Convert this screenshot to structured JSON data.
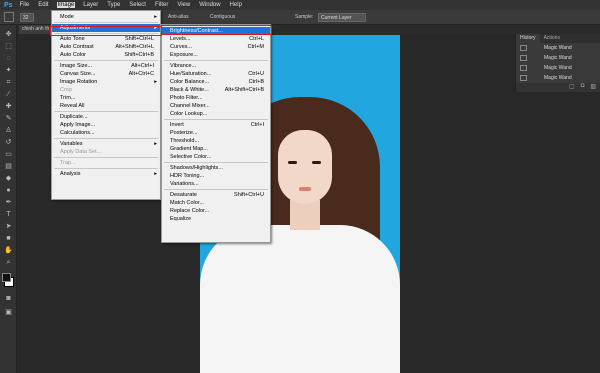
{
  "app": {
    "logo": "Ps",
    "menus": [
      "File",
      "Edit",
      "Image",
      "Layer",
      "Type",
      "Select",
      "Filter",
      "View",
      "Window",
      "Help"
    ],
    "active_menu": "Image"
  },
  "options": {
    "sample_size": "32",
    "antialias": "Anti-alias",
    "contiguous": "Contiguous",
    "sample_label": "Sample:",
    "sample_value": "Current Layer"
  },
  "document_tab": "chinh anh th",
  "image_menu": [
    {
      "label": "Mode",
      "arrow": true
    },
    {
      "sep": true
    },
    {
      "label": "Adjustments",
      "arrow": true,
      "highlight": true
    },
    {
      "sep": true
    },
    {
      "label": "Auto Tone",
      "shortcut": "Shift+Ctrl+L"
    },
    {
      "label": "Auto Contrast",
      "shortcut": "Alt+Shift+Ctrl+L"
    },
    {
      "label": "Auto Color",
      "shortcut": "Shift+Ctrl+B"
    },
    {
      "sep": true
    },
    {
      "label": "Image Size...",
      "shortcut": "Alt+Ctrl+I"
    },
    {
      "label": "Canvas Size...",
      "shortcut": "Alt+Ctrl+C"
    },
    {
      "label": "Image Rotation",
      "arrow": true
    },
    {
      "label": "Crop",
      "disabled": true
    },
    {
      "label": "Trim..."
    },
    {
      "label": "Reveal All"
    },
    {
      "sep": true
    },
    {
      "label": "Duplicate..."
    },
    {
      "label": "Apply Image..."
    },
    {
      "label": "Calculations..."
    },
    {
      "sep": true
    },
    {
      "label": "Variables",
      "arrow": true
    },
    {
      "label": "Apply Data Set...",
      "disabled": true
    },
    {
      "sep": true
    },
    {
      "label": "Trap...",
      "disabled": true
    },
    {
      "sep": true
    },
    {
      "label": "Analysis",
      "arrow": true
    }
  ],
  "adjust_menu": [
    {
      "label": "Brightness/Contrast...",
      "highlight": true
    },
    {
      "label": "Levels...",
      "shortcut": "Ctrl+L"
    },
    {
      "label": "Curves...",
      "shortcut": "Ctrl+M"
    },
    {
      "label": "Exposure..."
    },
    {
      "sep": true
    },
    {
      "label": "Vibrance..."
    },
    {
      "label": "Hue/Saturation...",
      "shortcut": "Ctrl+U"
    },
    {
      "label": "Color Balance...",
      "shortcut": "Ctrl+B"
    },
    {
      "label": "Black & White...",
      "shortcut": "Alt+Shift+Ctrl+B"
    },
    {
      "label": "Photo Filter..."
    },
    {
      "label": "Channel Mixer..."
    },
    {
      "label": "Color Lookup..."
    },
    {
      "sep": true
    },
    {
      "label": "Invert",
      "shortcut": "Ctrl+I"
    },
    {
      "label": "Posterize..."
    },
    {
      "label": "Threshold..."
    },
    {
      "label": "Gradient Map..."
    },
    {
      "label": "Selective Color..."
    },
    {
      "sep": true
    },
    {
      "label": "Shadows/Highlights..."
    },
    {
      "label": "HDR Toning..."
    },
    {
      "label": "Variations..."
    },
    {
      "sep": true
    },
    {
      "label": "Desaturate",
      "shortcut": "Shift+Ctrl+U"
    },
    {
      "label": "Match Color..."
    },
    {
      "label": "Replace Color..."
    },
    {
      "label": "Equalize"
    }
  ],
  "history": {
    "tabs": [
      "History",
      "Actions"
    ],
    "items": [
      "Magic Wand",
      "Magic Wand",
      "Magic Wand",
      "Magic Wand"
    ]
  },
  "colors": {
    "menu_highlight": "#1f74d6",
    "red_box": "#e0141c",
    "canvas_bg": "#21a6df"
  }
}
